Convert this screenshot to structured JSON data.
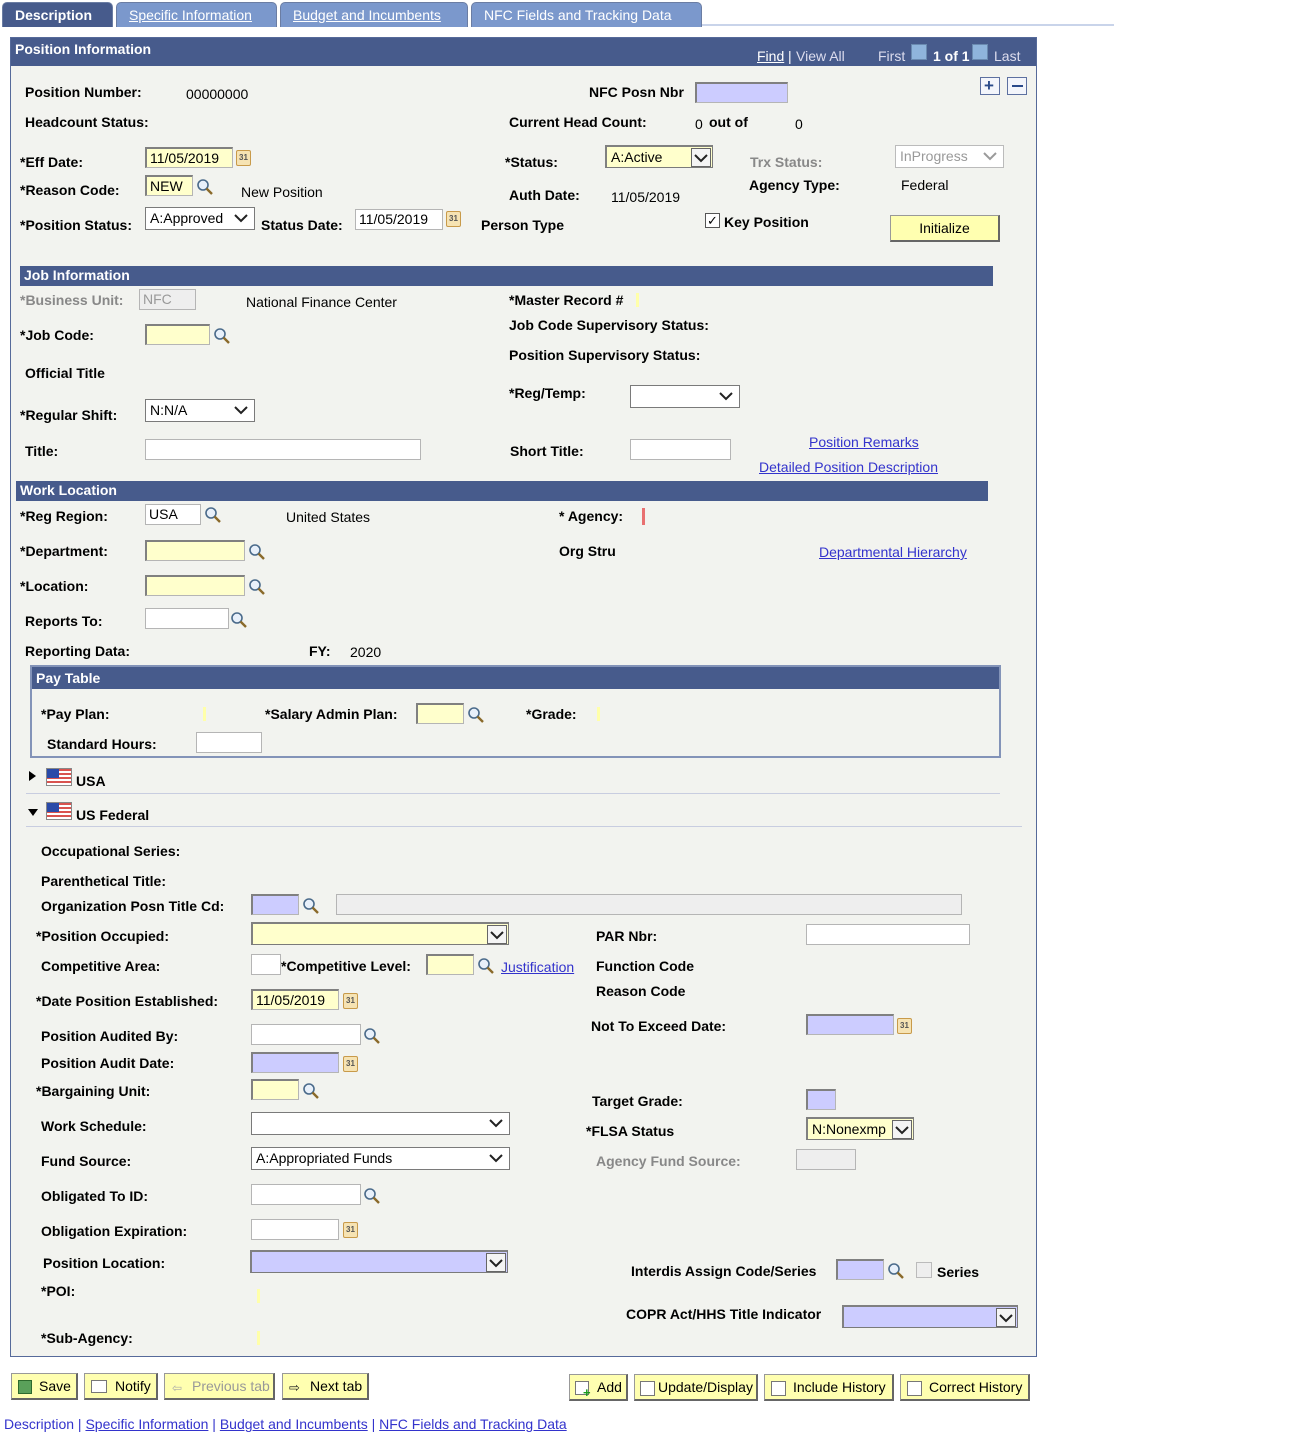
{
  "tabs": [
    {
      "label": "Description",
      "active": true
    },
    {
      "label": "Specific Information",
      "active": false
    },
    {
      "label": "Budget and Incumbents",
      "active": false
    },
    {
      "label": "NFC Fields and Tracking Data",
      "active": false
    }
  ],
  "position_info": {
    "header": "Position Information",
    "nav": {
      "find": "Find",
      "view_all": "View All",
      "first": "First",
      "count": "1 of 1",
      "last": "Last"
    },
    "position_number_label": "Position Number:",
    "position_number": "00000000",
    "nfc_posn_nbr_label": "NFC Posn Nbr",
    "headcount_status_label": "Headcount Status:",
    "current_head_count_label": "Current Head Count:",
    "current_head_count": "0",
    "out_of_label": "out of",
    "max_head_count": "0",
    "eff_date_label": "*Eff Date:",
    "eff_date": "11/05/2019",
    "status_label": "*Status:",
    "status": "A:Active",
    "trx_status_label": "Trx Status:",
    "trx_status": "InProgress",
    "reason_code_label": "*Reason Code:",
    "reason_code": "NEW",
    "reason_desc": "New Position",
    "auth_date_label": "Auth Date:",
    "auth_date": "11/05/2019",
    "agency_type_label": "Agency Type:",
    "agency_type": "Federal",
    "position_status_label": "*Position Status:",
    "position_status": "A:Approved",
    "status_date_label": "Status Date:",
    "status_date": "11/05/2019",
    "person_type_label": "Person Type",
    "key_position_label": "Key Position",
    "key_position_checked": true,
    "initialize_label": "Initialize"
  },
  "job_info": {
    "header": "Job Information",
    "business_unit_label": "*Business Unit:",
    "business_unit": "NFC",
    "business_unit_desc": "National Finance Center",
    "master_record_label": "*Master Record #",
    "job_code_label": "*Job Code:",
    "job_code_sup_label": "Job Code Supervisory Status:",
    "position_sup_label": "Position Supervisory Status:",
    "official_title_label": "Official Title",
    "reg_temp_label": "*Reg/Temp:",
    "reg_temp": "",
    "regular_shift_label": "*Regular Shift:",
    "regular_shift": "N:N/A",
    "title_label": "Title:",
    "short_title_label": "Short Title:",
    "position_remarks_link": "Position Remarks",
    "detailed_desc_link": "Detailed Position Description"
  },
  "work_location": {
    "header": "Work Location",
    "reg_region_label": "*Reg Region:",
    "reg_region": "USA",
    "reg_region_desc": "United States",
    "agency_label": "* Agency:",
    "department_label": "*Department:",
    "org_stru_label": "Org Stru",
    "dept_hierarchy_link": "Departmental Hierarchy",
    "location_label": "*Location:",
    "reports_to_label": "Reports To:",
    "reporting_data_label": "Reporting Data:",
    "fy_label": "FY:",
    "fy": "2020"
  },
  "pay_table": {
    "header": "Pay Table",
    "pay_plan_label": "*Pay Plan:",
    "salary_admin_plan_label": "*Salary Admin Plan:",
    "grade_label": "*Grade:",
    "standard_hours_label": "Standard Hours:"
  },
  "collapsibles": [
    {
      "label": "USA",
      "expanded": false
    },
    {
      "label": "US Federal",
      "expanded": true
    }
  ],
  "us_federal": {
    "occupational_series_label": "Occupational Series:",
    "parenthetical_title_label": "Parenthetical Title:",
    "org_posn_title_label": "Organization Posn Title Cd:",
    "position_occupied_label": "*Position Occupied:",
    "position_occupied": "",
    "par_nbr_label": "PAR Nbr:",
    "competitive_area_label": "Competitive Area:",
    "competitive_level_label": "*Competitive Level:",
    "justification_link": "Justification",
    "function_code_label": "Function Code",
    "reason_code_label": "Reason Code",
    "date_established_label": "*Date Position Established:",
    "date_established": "11/05/2019",
    "not_to_exceed_label": "Not To Exceed Date:",
    "audited_by_label": "Position Audited By:",
    "audit_date_label": "Position Audit Date:",
    "bargaining_unit_label": "*Bargaining Unit:",
    "target_grade_label": "Target Grade:",
    "work_schedule_label": "Work Schedule:",
    "work_schedule": "",
    "flsa_label": "*FLSA Status",
    "flsa": "N:Nonexmp",
    "fund_source_label": "Fund Source:",
    "fund_source": "A:Appropriated Funds",
    "agency_fund_source_label": "Agency Fund Source:",
    "obligated_to_label": "Obligated To ID:",
    "obligation_exp_label": "Obligation Expiration:",
    "position_location_label": "Position Location:",
    "position_location": "",
    "interdis_label": "Interdis Assign Code/Series",
    "series_label": "Series",
    "poi_label": "*POI:",
    "copr_label": "COPR Act/HHS Title Indicator",
    "copr": "",
    "sub_agency_label": "*Sub-Agency:"
  },
  "toolbar": {
    "save": "Save",
    "notify": "Notify",
    "previous_tab": "Previous tab",
    "next_tab": "Next tab",
    "add": "Add",
    "update_display": "Update/Display",
    "include_history": "Include History",
    "correct_history": "Correct History"
  },
  "footer_links": [
    {
      "label": "Description",
      "link": false
    },
    {
      "label": "Specific Information",
      "link": true
    },
    {
      "label": "Budget and Incumbents",
      "link": true
    },
    {
      "label": "NFC Fields and Tracking Data",
      "link": true
    }
  ]
}
